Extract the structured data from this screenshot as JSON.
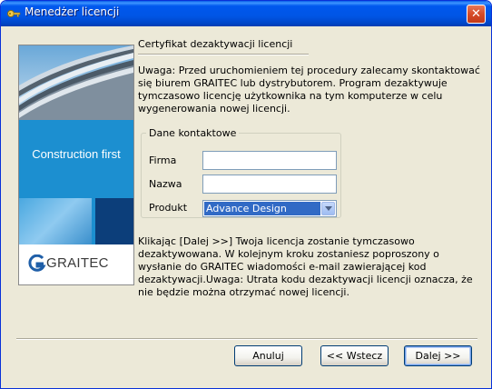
{
  "window": {
    "title": "Menedżer licencji",
    "icon": "key-icon",
    "close_label": "✕"
  },
  "banner": {
    "slogan": "Construction first",
    "logo_text": "GRAITEC",
    "colors": {
      "band": "#1c8fd0",
      "dark_tile": "#0c3e7a"
    }
  },
  "page": {
    "heading": "Certyfikat dezaktywacji licencji",
    "warning": "Uwaga: Przed uruchomieniem tej procedury zalecamy skontaktować się biurem GRAITEC lub dystrybutorem. Program dezaktywuje tymczasowo licencję użytkownika na tym komputerze w celu wygenerowania nowej licencji.",
    "contact_group": {
      "legend": "Dane kontaktowe",
      "firma_label": "Firma",
      "firma_value": "",
      "nazwa_label": "Nazwa",
      "nazwa_value": "",
      "produkt_label": "Produkt",
      "produkt_value": "Advance Design"
    },
    "info": "Klikając [Dalej >>] Twoja licencja zostanie tymczasowo dezaktywowana. W kolejnym kroku zostaniesz poproszony o wysłanie do GRAITEC wiadomości e-mail zawierającej kod dezaktywacji.Uwaga: Utrata kodu dezaktywacji licencji oznacza, że nie będzie można otrzymać nowej licencji."
  },
  "buttons": {
    "cancel": "Anuluj",
    "back": "<< Wstecz",
    "next": "Dalej >>"
  },
  "colors": {
    "titlebar": "#0055e5",
    "selection": "#316ac5",
    "dialog_bg": "#ece9d8"
  }
}
